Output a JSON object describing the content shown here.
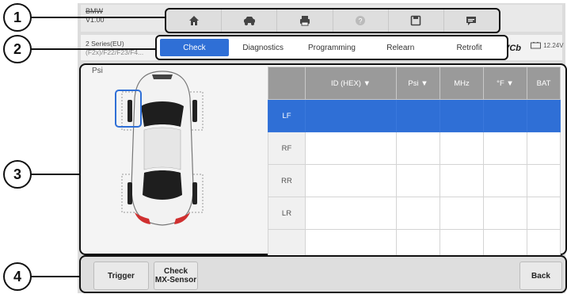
{
  "vehicle": {
    "make": "BMW",
    "version": "V1.00",
    "model": "2 Series(EU)",
    "chassis": "(F2x)/F22/F23/F4..."
  },
  "callouts": [
    "1",
    "2",
    "3",
    "4"
  ],
  "toolbar": {
    "icons": [
      "home-icon",
      "vehicle-icon",
      "print-icon",
      "help-icon",
      "save-icon",
      "message-icon"
    ]
  },
  "tabs": [
    {
      "label": "Check",
      "active": true
    },
    {
      "label": "Diagnostics",
      "active": false
    },
    {
      "label": "Programming",
      "active": false
    },
    {
      "label": "Relearn",
      "active": false
    },
    {
      "label": "Retrofit",
      "active": false
    }
  ],
  "status": {
    "vci": "VCb",
    "battery": "12.24V"
  },
  "pressure_unit": "Psi",
  "table": {
    "columns": [
      "",
      "ID (HEX) ▼",
      "Psi ▼",
      "MHz",
      "°F ▼",
      "BAT"
    ],
    "rows": [
      {
        "label": "LF",
        "selected": true
      },
      {
        "label": "RF",
        "selected": false
      },
      {
        "label": "RR",
        "selected": false
      },
      {
        "label": "LR",
        "selected": false
      },
      {
        "label": "",
        "selected": false
      }
    ]
  },
  "buttons": {
    "trigger": "Trigger",
    "check_line1": "Check",
    "check_line2": "MX-Sensor",
    "back": "Back"
  },
  "colors": {
    "accent": "#2f6fd6",
    "header": "#9a9a9a",
    "car_body": "#f2f2f2",
    "tail_light": "#d03030"
  }
}
